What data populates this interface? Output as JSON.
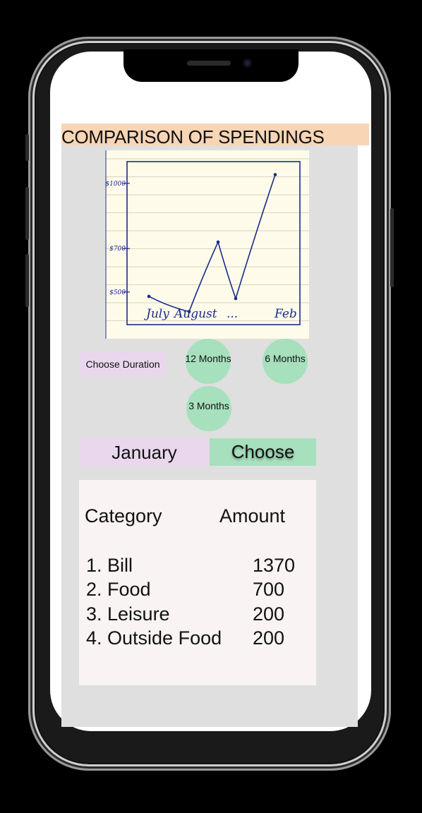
{
  "title": "COMPARISON OF SPENDINGS",
  "chart_data": {
    "type": "line",
    "categories": [
      "July",
      "August",
      "...",
      "Feb"
    ],
    "y_tick_labels": [
      "$1000",
      "$700",
      "$500"
    ],
    "series": [
      {
        "values": [
          480,
          410,
          730,
          470,
          1040
        ]
      }
    ],
    "ylim": [
      350,
      1100
    ],
    "grid": true
  },
  "duration": {
    "label": "Choose Duration",
    "options": [
      "12 Months",
      "6 Months",
      "3 Months"
    ]
  },
  "month_selector": {
    "value": "January",
    "choose_label": "Choose"
  },
  "table": {
    "headers": [
      "Category",
      "Amount"
    ],
    "rows": [
      {
        "name": "1. Bill",
        "amount": "1370"
      },
      {
        "name": "2. Food",
        "amount": "700"
      },
      {
        "name": "3. Leisure",
        "amount": "200"
      },
      {
        "name": "4. Outside Food",
        "amount": "200"
      }
    ]
  },
  "colors": {
    "title_bg": "#f8d5b5",
    "panel_bg": "#dfdfdf",
    "chart_bg": "#fefbea",
    "line": "#1a2a8a",
    "pill_purple": "#ead7ee",
    "pill_green": "#a6e0bd",
    "table_bg": "#f9f3f3"
  }
}
